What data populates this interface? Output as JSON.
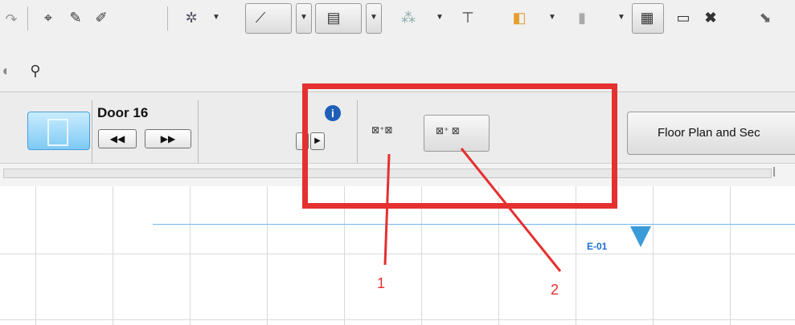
{
  "toolbar": {
    "row1_icons": [
      "redo-icon",
      "magic-wand-icon",
      "eyedropper-icon",
      "inject-icon",
      "snap-guide-icon",
      "angle-icon",
      "label-tool-icon",
      "grid-snap-icon",
      "dimension-icon",
      "layer-combo-icon",
      "pen-set-icon",
      "marquee-selected-icon",
      "ruler-icon",
      "close-cross-icon",
      "eraser-icon"
    ],
    "row2_icons": [
      "walkthrough-icon"
    ]
  },
  "info_box": {
    "element_name": "Door 16",
    "prev_label": "◀◀",
    "next_label": "▶▶",
    "info_label": "i",
    "view_button_label": "Floor Plan and Sec"
  },
  "canvas": {
    "elevation_label": "E-01",
    "accent_color": "#3a9bd8"
  },
  "annotations": {
    "callout_1": "1",
    "callout_2": "2",
    "highlight_color": "#e53030"
  }
}
